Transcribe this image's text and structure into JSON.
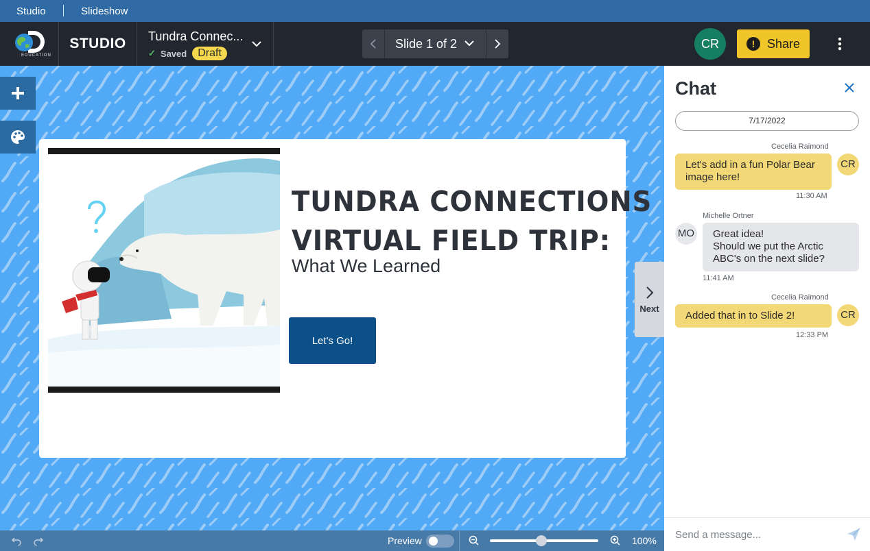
{
  "topbar": {
    "crumb_studio": "Studio",
    "crumb_slideshow": "Slideshow"
  },
  "header": {
    "logo_text": "EDUCATION",
    "app_name": "STUDIO",
    "doc_title": "Tundra Connec...",
    "saved_label": "Saved",
    "draft_label": "Draft",
    "slide_label": "Slide 1 of 2",
    "user_initials": "CR",
    "share_label": "Share"
  },
  "slide": {
    "title_line1": "TUNDRA CONNECTIONS",
    "title_line2": "VIRTUAL FIELD TRIP:",
    "subtitle": "What We Learned",
    "button_label": "Let's Go!",
    "next_label": "Next"
  },
  "bottombar": {
    "preview_label": "Preview",
    "zoom_percent": "100%",
    "zoom_level": 0.5,
    "preview_on": false
  },
  "chat": {
    "title": "Chat",
    "date": "7/17/2022",
    "messages": [
      {
        "sender": "Cecelia Raimond",
        "initials": "CR",
        "text_lines": [
          "Let's add in a fun Polar Bear",
          "image here!"
        ],
        "time": "11:30 AM",
        "mine": true
      },
      {
        "sender": "Michelle Ortner",
        "initials": "MO",
        "text_lines": [
          "Great idea!",
          "Should we put the Arctic",
          "ABC's on the next slide?"
        ],
        "time": "11:41 AM",
        "mine": false
      },
      {
        "sender": "Cecelia Raimond",
        "initials": "CR",
        "text_lines": [
          "Added that in to Slide 2!"
        ],
        "time": "12:33 PM",
        "mine": true
      }
    ],
    "input_placeholder": "Send a message..."
  },
  "colors": {
    "header_bg": "#22272f",
    "topstrip_bg": "#2f6aa4",
    "canvas_bg": "#52a9f5",
    "accent_yellow": "#f0c529",
    "button_blue": "#0c508a",
    "avatar_green": "#167f62"
  }
}
